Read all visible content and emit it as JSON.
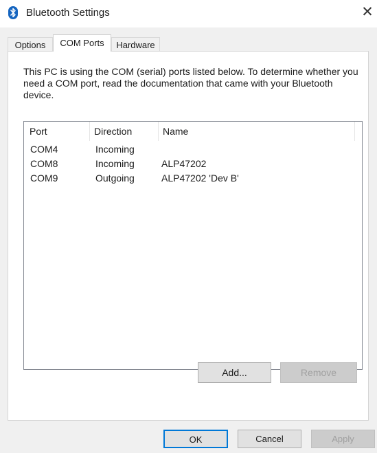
{
  "window": {
    "title": "Bluetooth Settings",
    "close_glyph": "✕"
  },
  "tabs": [
    {
      "label": "Options",
      "active": false
    },
    {
      "label": "COM Ports",
      "active": true
    },
    {
      "label": "Hardware",
      "active": false
    }
  ],
  "description": "This PC is using the COM (serial) ports listed below. To determine whether you need a COM port, read the documentation that came with your Bluetooth device.",
  "table": {
    "columns": [
      "Port",
      "Direction",
      "Name"
    ],
    "rows": [
      {
        "port": "COM4",
        "direction": "Incoming",
        "name": ""
      },
      {
        "port": "COM8",
        "direction": "Incoming",
        "name": "ALP47202"
      },
      {
        "port": "COM9",
        "direction": "Outgoing",
        "name": "ALP47202 'Dev B'"
      }
    ]
  },
  "buttons": {
    "add": "Add...",
    "remove": "Remove",
    "ok": "OK",
    "cancel": "Cancel",
    "apply": "Apply"
  },
  "colors": {
    "accent": "#0078d7",
    "bluetooth_icon": "#1565c0"
  },
  "icons": {
    "title": "bluetooth-icon",
    "close": "close-icon"
  }
}
